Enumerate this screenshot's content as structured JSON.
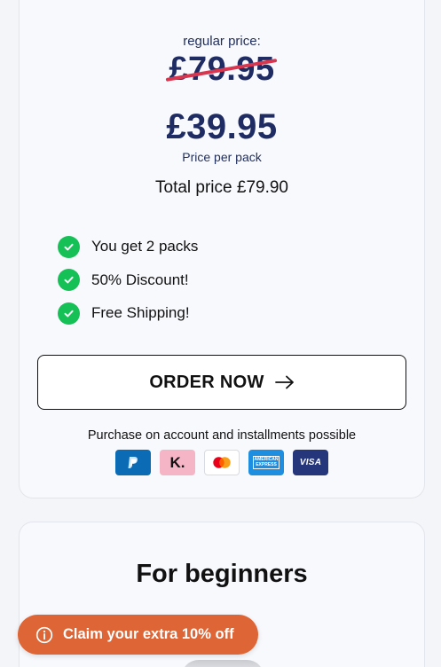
{
  "pricing": {
    "regular_label": "regular price:",
    "regular_price": "£79.95",
    "price": "£39.95",
    "per_pack_label": "Price per pack",
    "total_price": "Total price £79.90"
  },
  "features": [
    {
      "label": "You get 2 packs",
      "icon": "check-icon"
    },
    {
      "label": "50% Discount!",
      "icon": "check-icon"
    },
    {
      "label": "Free Shipping!",
      "icon": "check-icon"
    }
  ],
  "order_button": {
    "label": "ORDER NOW",
    "icon": "arrow-right-icon"
  },
  "payment": {
    "note": "Purchase on account and installments possible",
    "methods": [
      {
        "name": "PayPal",
        "icon": "paypal-icon"
      },
      {
        "name": "Klarna",
        "icon": "klarna-icon",
        "text": "K."
      },
      {
        "name": "Mastercard",
        "icon": "mastercard-icon"
      },
      {
        "name": "American Express",
        "icon": "amex-icon",
        "text": "AMERICAN EXPRESS"
      },
      {
        "name": "Visa",
        "icon": "visa-icon",
        "text": "VISA"
      }
    ]
  },
  "next_section": {
    "title": "For beginners"
  },
  "promo_button": {
    "label": "Claim your extra 10% off",
    "icon": "info-icon"
  },
  "colors": {
    "price_navy": "#1e2c63",
    "strike_red": "#d8354f",
    "check_green": "#15c057",
    "promo_orange": "#dd6536"
  }
}
